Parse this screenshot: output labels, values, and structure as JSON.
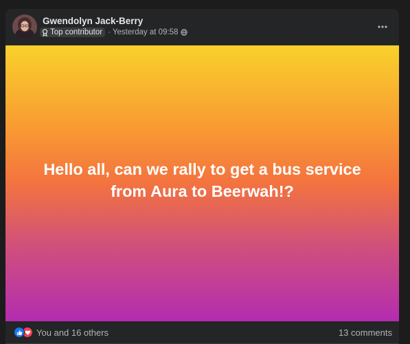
{
  "post": {
    "author": "Gwendolyn Jack-Berry",
    "badge": "Top contributor",
    "separator": "·",
    "timestamp": "Yesterday at 09:58",
    "body": "Hello all, can we rally to get a bus service from Aura to Beerwah!?"
  },
  "footer": {
    "reactions_text": "You and 16 others",
    "comments_text": "13 comments"
  },
  "icons": {
    "avatar": "profile-photo",
    "badge": "contributor-badge-icon",
    "privacy": "globe-icon",
    "more": "more-horizontal-icon",
    "like": "like-icon",
    "love": "love-icon"
  },
  "colors": {
    "card_bg": "#242526",
    "text_primary": "#e4e6eb",
    "text_secondary": "#b0b3b8",
    "like_blue": "#1877f2",
    "love_red": "#f33e58",
    "gradient_top": "#f9d12b",
    "gradient_mid": "#f3733f",
    "gradient_bottom": "#b32cb0"
  }
}
